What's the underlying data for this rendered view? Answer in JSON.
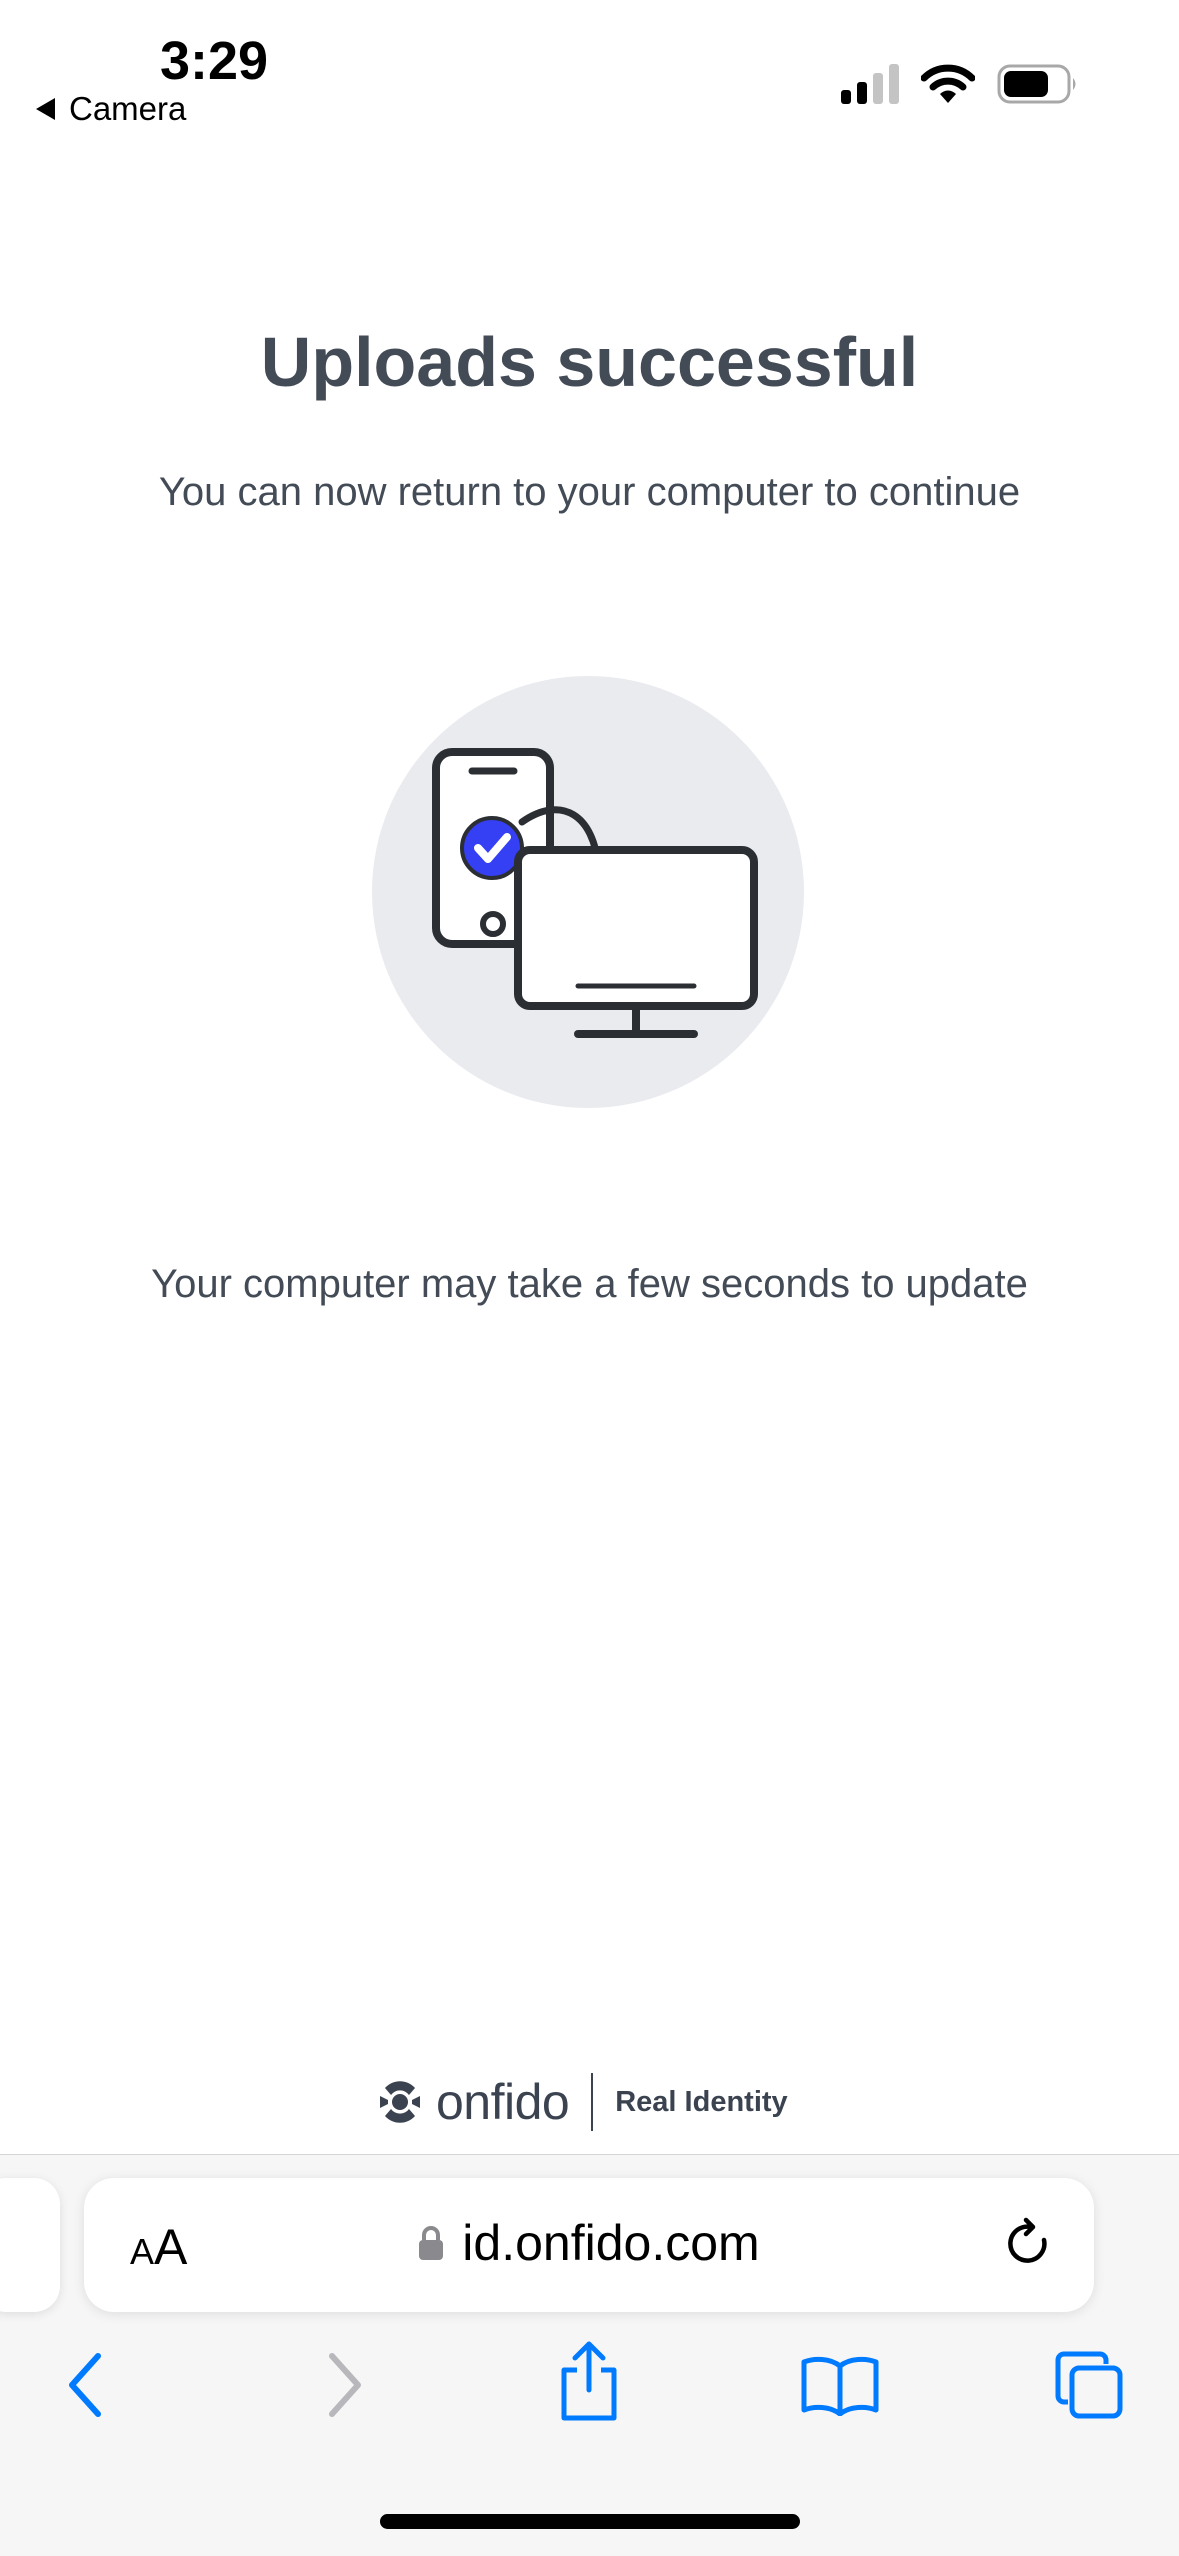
{
  "status_bar": {
    "time": "3:29",
    "back_label": "Camera",
    "icons": [
      "cellular-signal-icon",
      "wifi-icon",
      "battery-icon"
    ]
  },
  "main": {
    "title": "Uploads successful",
    "subtitle": "You can now return to your computer to continue",
    "illustration": "phone-to-computer-transfer-icon",
    "note": "Your computer may take a few seconds to update"
  },
  "footer": {
    "brand_name": "onfido",
    "brand_tagline": "Real Identity"
  },
  "browser": {
    "text_size_label_small": "A",
    "text_size_label_large": "A",
    "url": "id.onfido.com",
    "toolbar_icons": [
      "back-icon",
      "forward-icon",
      "share-icon",
      "bookmarks-icon",
      "tabs-icon"
    ]
  },
  "colors": {
    "text": "#434b56",
    "accent": "#353ff4",
    "illustration_bg": "#e9ebef",
    "safari_blue": "#007aff",
    "disabled_gray": "#b8b8bc"
  }
}
